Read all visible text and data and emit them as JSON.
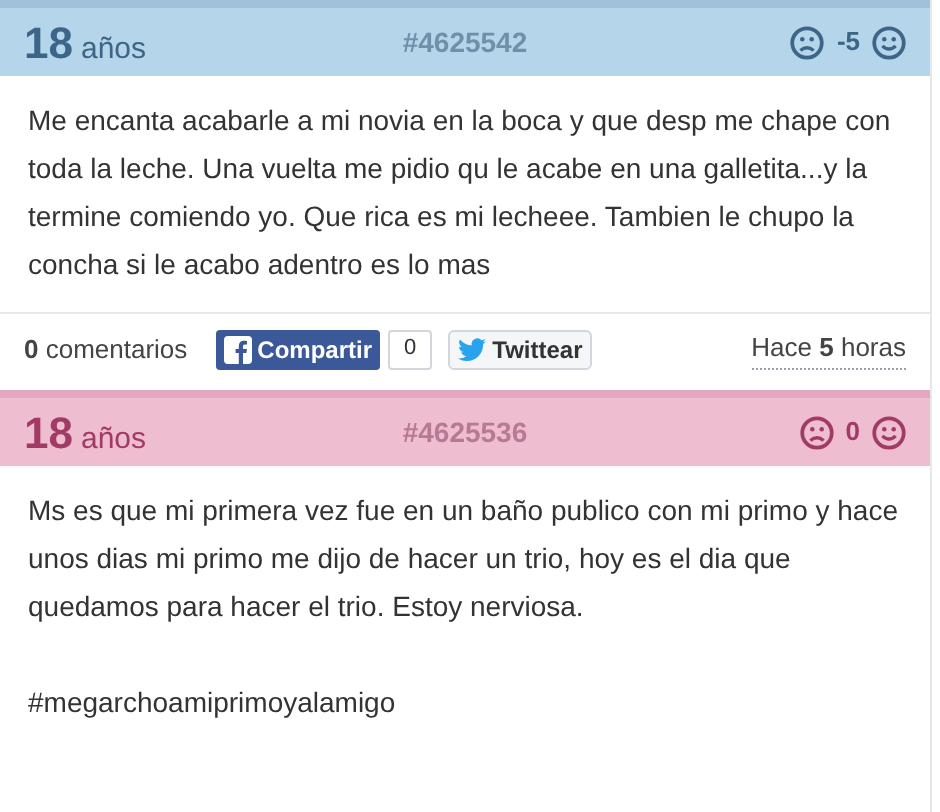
{
  "posts": [
    {
      "kind": "male",
      "age": "18",
      "age_unit": "años",
      "id": "#4625542",
      "score": "-5",
      "paragraphs": [
        "Me encanta acabarle a mi novia en la boca y que desp me chape con toda la leche. Una vuelta me pidio qu le acabe en una galletita...y la termine comiendo yo. Que rica es mi lecheee. Tambien le chupo la concha si le acabo adentro es lo mas"
      ],
      "footer": {
        "comments": "**0** comentarios",
        "share": "Compartir",
        "share_count": "0",
        "tweet": "Twittear",
        "time": "Hace **5** horas"
      }
    },
    {
      "kind": "female",
      "age": "18",
      "age_unit": "años",
      "id": "#4625536",
      "score": "0",
      "paragraphs": [
        "Ms es que mi primera vez fue en un baño publico con mi primo y hace unos dias mi primo me dijo de hacer un trio, hoy es el dia que quedamos para hacer el trio. Estoy nerviosa.",
        "#megarchoamiprimoyalamigo"
      ]
    }
  ]
}
